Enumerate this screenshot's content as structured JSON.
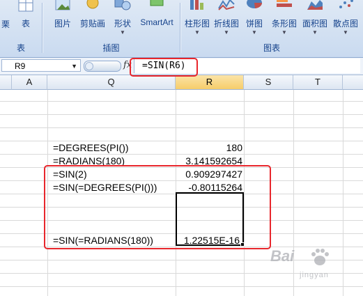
{
  "ribbon": {
    "items": [
      {
        "label": "表",
        "has_dropdown": false
      },
      {
        "label": "图片",
        "has_dropdown": false
      },
      {
        "label": "剪贴画",
        "has_dropdown": false
      },
      {
        "label": "形状",
        "has_dropdown": true
      },
      {
        "label": "SmartArt",
        "has_dropdown": false
      },
      {
        "label": "柱形图",
        "has_dropdown": true
      },
      {
        "label": "折线图",
        "has_dropdown": true
      },
      {
        "label": "饼图",
        "has_dropdown": true
      },
      {
        "label": "条形图",
        "has_dropdown": true
      },
      {
        "label": "面积图",
        "has_dropdown": true
      },
      {
        "label": "散点图",
        "has_dropdown": true
      }
    ],
    "partial_left_label": "表",
    "groups": {
      "tables": "表",
      "illustrations": "插图",
      "charts": "图表"
    }
  },
  "formula_bar": {
    "name_box": "R9",
    "fx": "fx",
    "formula": "=SIN(R6)"
  },
  "columns": [
    "A",
    "Q",
    "R",
    "S",
    "T"
  ],
  "selected_column": "R",
  "rows": [
    {
      "q": "=DEGREES(PI())",
      "r": "180"
    },
    {
      "q": "=RADIANS(180)",
      "r": "3.141592654"
    },
    {
      "q": "=SIN(2)",
      "r": "0.909297427"
    },
    {
      "q": "=SIN(=DEGREES(PI()))",
      "r": "-0.80115264"
    },
    {
      "q": "",
      "r": ""
    },
    {
      "q": "",
      "r": ""
    },
    {
      "q": "",
      "r": ""
    },
    {
      "q": "=SIN(=RADIANS(180))",
      "r": "1.22515E-16"
    }
  ],
  "annotation_color": "#e8262c",
  "selection_color": "#f6cd6a",
  "watermark": {
    "logo": "Bai",
    "text": "jingyan"
  }
}
